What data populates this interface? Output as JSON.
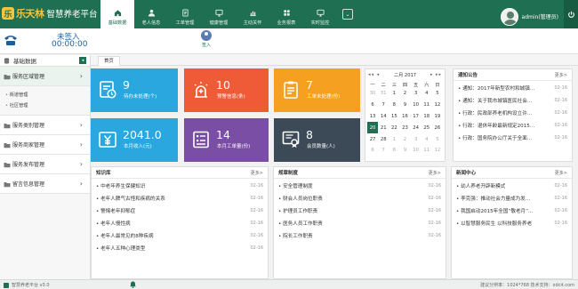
{
  "app": {
    "logo_mark": "乐",
    "brand": "乐天林",
    "title": "智慧养老平台"
  },
  "nav": {
    "items": [
      {
        "label": "基础数据",
        "icon": "home-icon",
        "active": true
      },
      {
        "label": "老人信息",
        "icon": "user-icon",
        "active": false
      },
      {
        "label": "工单管理",
        "icon": "document-icon",
        "active": false
      },
      {
        "label": "健康管理",
        "icon": "monitor-icon",
        "active": false
      },
      {
        "label": "主动关怀",
        "icon": "chart-icon",
        "active": false
      },
      {
        "label": "业务报表",
        "icon": "grid-icon",
        "active": false
      },
      {
        "label": "实时监控",
        "icon": "monitor-icon",
        "active": false
      }
    ],
    "more_glyph": "⌄"
  },
  "user": {
    "name": "admin(管理员)"
  },
  "signin": {
    "status": "未签入",
    "timer": "00:00:00",
    "button_label": "签入"
  },
  "sidebar": {
    "header": "基础数据",
    "collapse_glyph": "◂",
    "groups": [
      {
        "label": "服务区域管理",
        "expanded": true,
        "children": [
          "街道管理",
          "社区管理"
        ]
      },
      {
        "label": "服务类别管理",
        "expanded": false,
        "children": []
      },
      {
        "label": "服务商家管理",
        "expanded": false,
        "children": []
      },
      {
        "label": "服务发布管理",
        "expanded": false,
        "children": []
      },
      {
        "label": "留言信息管理",
        "expanded": false,
        "children": []
      }
    ]
  },
  "tabs": {
    "active": "首页"
  },
  "tiles": [
    {
      "value": "9",
      "label": "待办未处理(个)",
      "color": "#2aa7df",
      "icon": "clock-doc-icon"
    },
    {
      "value": "10",
      "label": "预警信息(条)",
      "color": "#ee5b36",
      "icon": "alarm-icon"
    },
    {
      "value": "7",
      "label": "工单未处理(份)",
      "color": "#f5a020",
      "icon": "clipboard-icon"
    },
    {
      "value": "2041.0",
      "label": "本月收入(元)",
      "color": "#2aa7df",
      "icon": "yen-icon"
    },
    {
      "value": "14",
      "label": "本月工单量(份)",
      "color": "#7b4ea6",
      "icon": "form-icon"
    },
    {
      "value": "8",
      "label": "会员数量(人)",
      "color": "#3b4a56",
      "icon": "certificate-icon"
    }
  ],
  "calendar": {
    "prev_year": "◂◂",
    "prev_month": "◂",
    "title": "二月 2017",
    "next_month": "▸",
    "next_year": "▸▸",
    "weekdays": [
      "一",
      "二",
      "三",
      "四",
      "五",
      "六",
      "日"
    ],
    "weeks": [
      [
        "30",
        "31",
        "1",
        "2",
        "3",
        "4",
        "5"
      ],
      [
        "6",
        "7",
        "8",
        "9",
        "10",
        "11",
        "12"
      ],
      [
        "13",
        "14",
        "15",
        "16",
        "17",
        "18",
        "19"
      ],
      [
        "20",
        "21",
        "22",
        "23",
        "24",
        "25",
        "26"
      ],
      [
        "27",
        "28",
        "1",
        "2",
        "3",
        "4",
        "5"
      ],
      [
        "6",
        "7",
        "8",
        "9",
        "10",
        "11",
        "12"
      ]
    ],
    "today": "20"
  },
  "panels": {
    "notice": {
      "title": "通知公告",
      "more": "更多>",
      "rows": [
        {
          "text": "通知：2017年新型农村和城镇...",
          "date": "02-16"
        },
        {
          "text": "通知：关于我市城镇医民社会...",
          "date": "02-16"
        },
        {
          "text": "行政：民政部养老机构设立许...",
          "date": "02-16"
        },
        {
          "text": "行政：退休年龄最新规定2015...",
          "date": "02-16"
        },
        {
          "text": "行政：国务院办公厅关于全面...",
          "date": "02-16"
        }
      ]
    },
    "knowledge": {
      "title": "知识库",
      "more": "更多>",
      "rows": [
        {
          "text": "中老年养生保健知识",
          "date": "02-16"
        },
        {
          "text": "老年人脾气古怪和疾病的关系",
          "date": "02-16"
        },
        {
          "text": "警惕老年抑郁症",
          "date": "02-16"
        },
        {
          "text": "老年人慢性病",
          "date": "02-16"
        },
        {
          "text": "老年人最常见的8种疾病",
          "date": "02-16"
        },
        {
          "text": "老年人五种心理类型",
          "date": "02-16"
        }
      ]
    },
    "rules": {
      "title": "规章制度",
      "more": "更多>",
      "rows": [
        {
          "text": "安全管理制度",
          "date": "02-16"
        },
        {
          "text": "财会人员岗位职责",
          "date": "02-16"
        },
        {
          "text": "护理员工作职责",
          "date": "02-16"
        },
        {
          "text": "医务人员工作职责",
          "date": "02-16"
        },
        {
          "text": "院长工作职责",
          "date": "02-16"
        }
      ]
    },
    "news": {
      "title": "新闻中心",
      "more": "更多>",
      "rows": [
        {
          "text": "幼人养老开辟新模式",
          "date": "02-16"
        },
        {
          "text": "李克强：推动社会力量成为发...",
          "date": "02-16"
        },
        {
          "text": "我国启动2015年全国“敬老月”...",
          "date": "02-16"
        },
        {
          "text": "以智慧服务民生 以科技服务养老",
          "date": "02-16"
        }
      ]
    }
  },
  "status": {
    "left": "智慧养老平台 v3.0",
    "right": "建议分辨率：1024*768   技术支持：xdcit.com"
  },
  "colors": {
    "primary": "#1f6f52",
    "brand_gold": "#f4c542",
    "signin_blue": "#1f5e9a"
  }
}
